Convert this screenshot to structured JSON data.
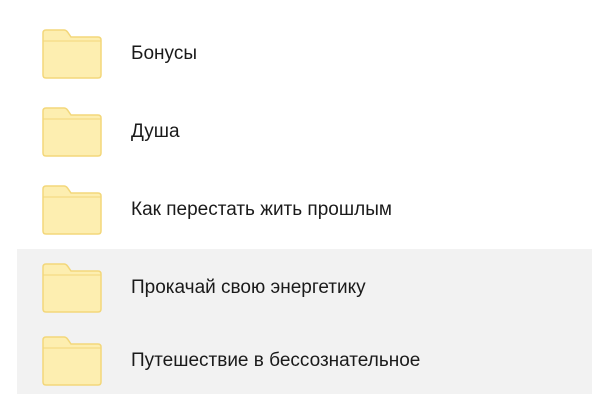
{
  "folders": [
    {
      "name": "Бонусы",
      "icon": "folder-icon",
      "highlighted": false
    },
    {
      "name": "Душа",
      "icon": "folder-icon",
      "highlighted": false
    },
    {
      "name": "Как перестать жить прошлым",
      "icon": "folder-icon",
      "highlighted": false
    },
    {
      "name": "Прокачай свою энергетику",
      "icon": "folder-icon",
      "highlighted": true
    },
    {
      "name": "Путешествие в бессознательное",
      "icon": "folder-icon",
      "highlighted": true
    }
  ],
  "colors": {
    "folder_fill": "#fdeeb0",
    "folder_stroke": "#f3d77a",
    "highlight_bg": "#f2f2f2",
    "text": "#1a1a1a"
  }
}
